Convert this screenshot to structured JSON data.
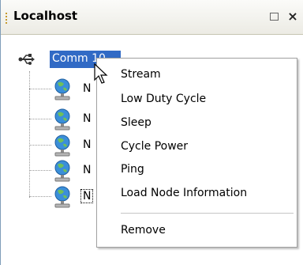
{
  "panel": {
    "title": "Localhost",
    "restore_icon": "restore-icon",
    "close_symbol": "×"
  },
  "tree": {
    "root": {
      "label": "Comm 10",
      "icon": "usb-icon"
    },
    "nodes": [
      {
        "label": "N",
        "icon": "globe-icon"
      },
      {
        "label": "N",
        "icon": "globe-icon"
      },
      {
        "label": "N",
        "icon": "globe-icon"
      },
      {
        "label": "N",
        "icon": "globe-icon"
      },
      {
        "label": "N",
        "icon": "globe-icon"
      }
    ]
  },
  "context_menu": {
    "items": [
      "Stream",
      "Low Duty Cycle",
      "Sleep",
      "Cycle Power",
      "Ping",
      "Load Node Information"
    ],
    "after_separator": [
      "Remove"
    ]
  },
  "colors": {
    "selection": "#316ac5",
    "title_bar": "#ecebe4",
    "menu_border": "#a0a0a0"
  }
}
